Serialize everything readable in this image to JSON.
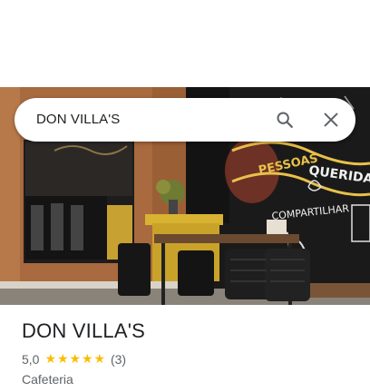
{
  "search": {
    "query": "DON VILLA'S",
    "search_icon": "search-icon",
    "close_icon": "close-icon"
  },
  "photo": {
    "wall_text_line1": "PESSOAS",
    "wall_text_line2": "QUERIDAS",
    "wall_text_line3": "COMPARTILHAR"
  },
  "place": {
    "title": "DON VILLA'S",
    "rating": "5,0",
    "stars": 5,
    "review_count": "(3)",
    "category": "Cafeteria"
  },
  "colors": {
    "star": "#fbbc04",
    "text_primary": "#202124",
    "text_secondary": "#5f6368"
  }
}
